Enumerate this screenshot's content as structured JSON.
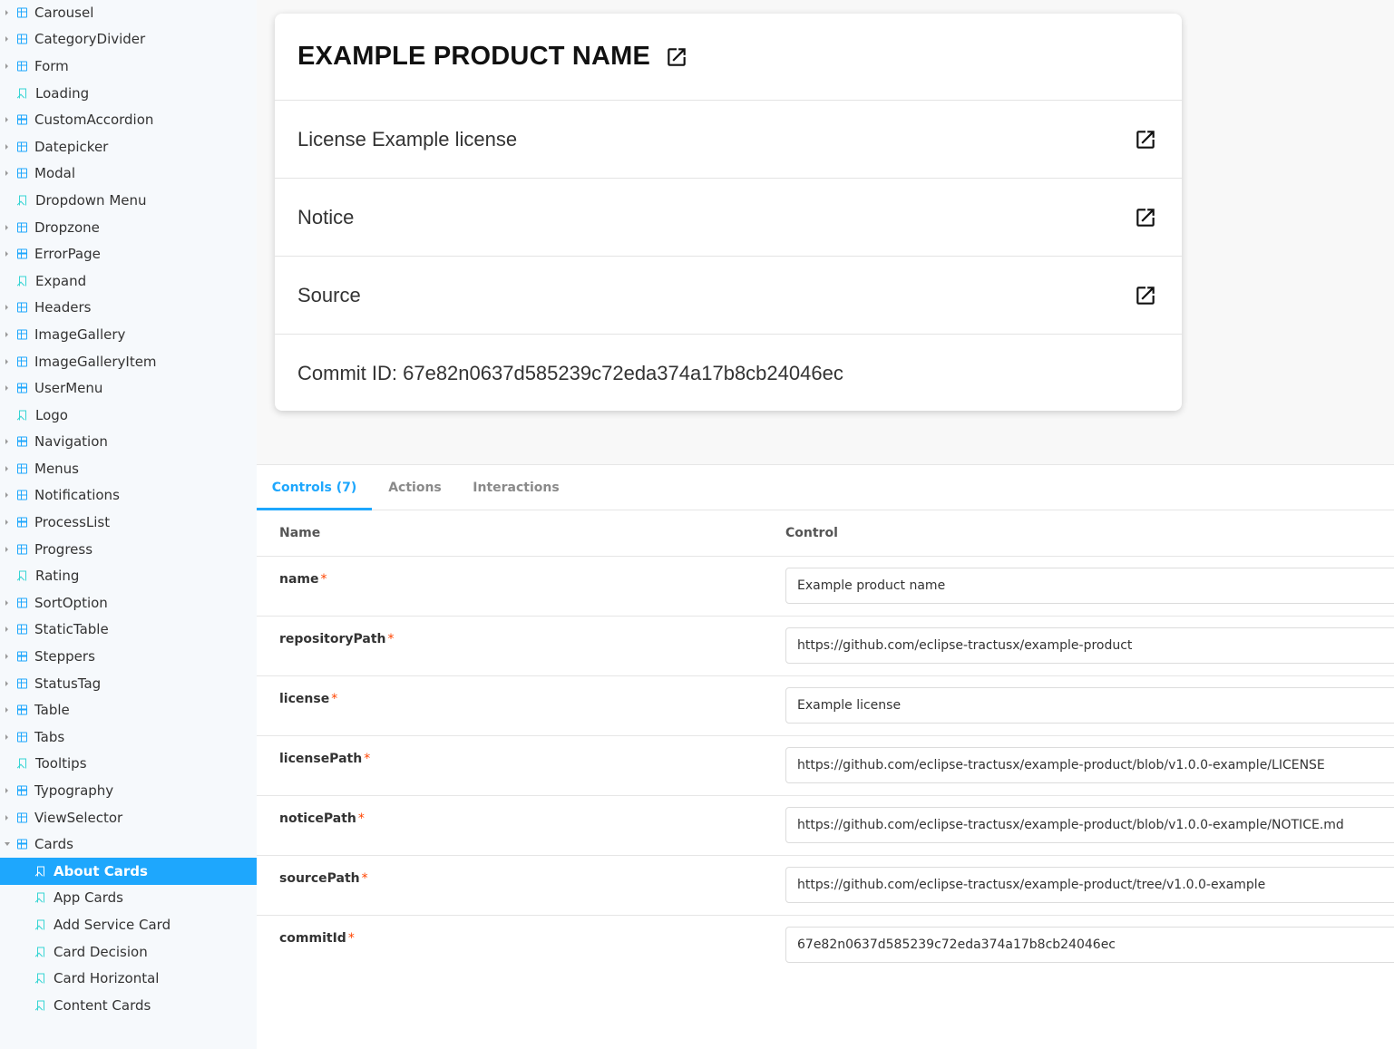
{
  "sidebar": {
    "items": [
      {
        "label": "Carousel",
        "type": "component"
      },
      {
        "label": "CategoryDivider",
        "type": "component"
      },
      {
        "label": "Form",
        "type": "component"
      },
      {
        "label": "Loading",
        "type": "story"
      },
      {
        "label": "CustomAccordion",
        "type": "component"
      },
      {
        "label": "Datepicker",
        "type": "component"
      },
      {
        "label": "Modal",
        "type": "component"
      },
      {
        "label": "Dropdown Menu",
        "type": "story"
      },
      {
        "label": "Dropzone",
        "type": "component"
      },
      {
        "label": "ErrorPage",
        "type": "component"
      },
      {
        "label": "Expand",
        "type": "story"
      },
      {
        "label": "Headers",
        "type": "component"
      },
      {
        "label": "ImageGallery",
        "type": "component"
      },
      {
        "label": "ImageGalleryItem",
        "type": "component"
      },
      {
        "label": "UserMenu",
        "type": "component"
      },
      {
        "label": "Logo",
        "type": "story"
      },
      {
        "label": "Navigation",
        "type": "component"
      },
      {
        "label": "Menus",
        "type": "component"
      },
      {
        "label": "Notifications",
        "type": "component"
      },
      {
        "label": "ProcessList",
        "type": "component"
      },
      {
        "label": "Progress",
        "type": "component"
      },
      {
        "label": "Rating",
        "type": "story"
      },
      {
        "label": "SortOption",
        "type": "component"
      },
      {
        "label": "StaticTable",
        "type": "component"
      },
      {
        "label": "Steppers",
        "type": "component"
      },
      {
        "label": "StatusTag",
        "type": "component"
      },
      {
        "label": "Table",
        "type": "component"
      },
      {
        "label": "Tabs",
        "type": "component"
      },
      {
        "label": "Tooltips",
        "type": "story"
      },
      {
        "label": "Typography",
        "type": "component"
      },
      {
        "label": "ViewSelector",
        "type": "component"
      },
      {
        "label": "Cards",
        "type": "component-open"
      }
    ],
    "children": [
      {
        "label": "About Cards",
        "active": true
      },
      {
        "label": "App Cards"
      },
      {
        "label": "Add Service Card"
      },
      {
        "label": "Card Decision"
      },
      {
        "label": "Card Horizontal"
      },
      {
        "label": "Content Cards"
      }
    ]
  },
  "card": {
    "title": "EXAMPLE PRODUCT NAME",
    "license": "License Example license",
    "notice": "Notice",
    "source": "Source",
    "commit": "Commit ID: 67e82n0637d585239c72eda374a17b8cb24046ec"
  },
  "tabs": {
    "controls": "Controls (7)",
    "actions": "Actions",
    "interactions": "Interactions"
  },
  "table": {
    "col_name": "Name",
    "col_control": "Control",
    "required_mark": "*",
    "rows": [
      {
        "name": "name",
        "value": "Example product name"
      },
      {
        "name": "repositoryPath",
        "value": "https://github.com/eclipse-tractusx/example-product"
      },
      {
        "name": "license",
        "value": "Example license"
      },
      {
        "name": "licensePath",
        "value": "https://github.com/eclipse-tractusx/example-product/blob/v1.0.0-example/LICENSE"
      },
      {
        "name": "noticePath",
        "value": "https://github.com/eclipse-tractusx/example-product/blob/v1.0.0-example/NOTICE.md"
      },
      {
        "name": "sourcePath",
        "value": "https://github.com/eclipse-tractusx/example-product/tree/v1.0.0-example"
      },
      {
        "name": "commitId",
        "value": "67e82n0637d585239c72eda374a17b8cb24046ec"
      }
    ]
  },
  "colors": {
    "accent": "#1ea7fd",
    "story_icon": "#37d5d3",
    "required": "#ff4400"
  },
  "icons": {
    "component": "component-grid-icon",
    "story": "bookmark-icon",
    "external": "open-in-new-icon"
  }
}
